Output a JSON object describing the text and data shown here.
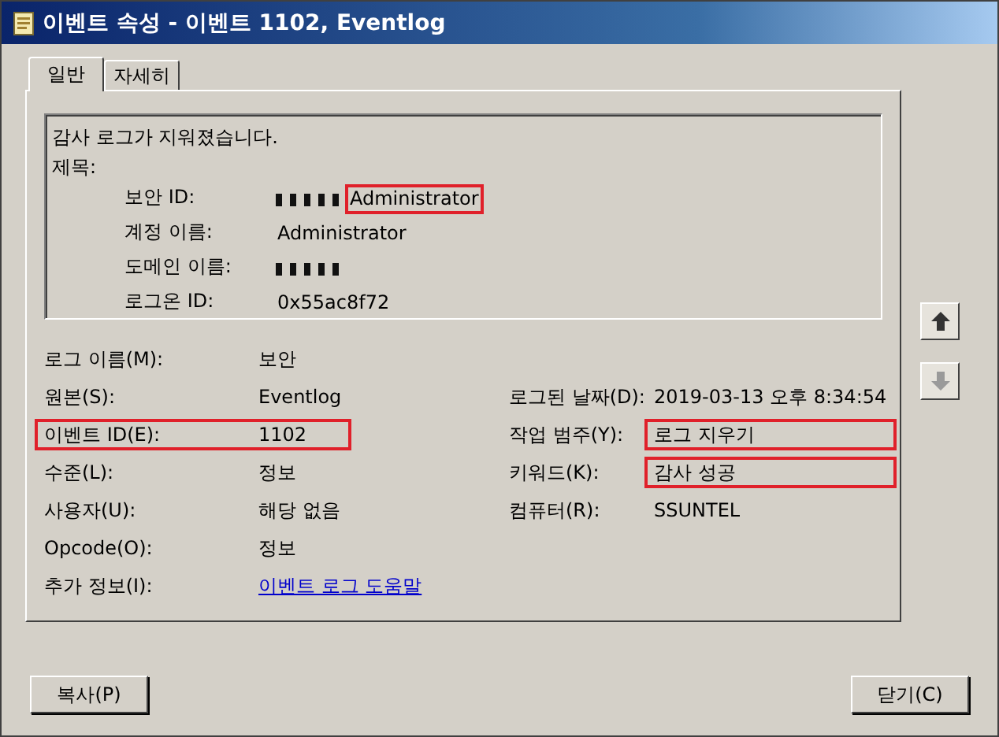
{
  "window": {
    "title": "이벤트 속성 - 이벤트 1102, Eventlog"
  },
  "tabs": [
    {
      "label": "일반",
      "selected": true
    },
    {
      "label": "자세히",
      "selected": false
    }
  ],
  "description": {
    "message": "감사 로그가 지워졌습니다.",
    "subject_label": "제목:",
    "details": [
      {
        "label": "보안 ID:",
        "value": "Administrator",
        "redacted_prefix": true,
        "highlighted": true
      },
      {
        "label": "계정 이름:",
        "value": "Administrator",
        "redacted_prefix": false,
        "highlighted": false
      },
      {
        "label": "도메인 이름:",
        "redacted_prefix": true,
        "highlighted": false
      },
      {
        "label": "로그온 ID:",
        "value": "0x55ac8f72",
        "redacted_prefix": false,
        "highlighted": false
      }
    ]
  },
  "fields": [
    {
      "left": {
        "label": "로그 이름(M):",
        "value": "보안",
        "kind": "text",
        "highlighted": false
      }
    },
    {
      "left": {
        "label": "원본(S):",
        "value": "Eventlog",
        "kind": "text",
        "highlighted": false
      },
      "right": {
        "label": "로그된 날짜(D):",
        "value": "2019-03-13 오후 8:34:54",
        "kind": "text",
        "highlighted": false
      }
    },
    {
      "left": {
        "label": "이벤트 ID(E):",
        "value": "1102",
        "kind": "text",
        "highlighted": true
      },
      "right": {
        "label": "작업 범주(Y):",
        "value": "로그 지우기",
        "kind": "text",
        "highlighted": true
      }
    },
    {
      "left": {
        "label": "수준(L):",
        "value": "정보",
        "kind": "text",
        "highlighted": false
      },
      "right": {
        "label": "키워드(K):",
        "value": "감사 성공",
        "kind": "text",
        "highlighted": true
      }
    },
    {
      "left": {
        "label": "사용자(U):",
        "value": "해당 없음",
        "kind": "text",
        "highlighted": false
      },
      "right": {
        "label": "컴퓨터(R):",
        "value": "SSUNTEL",
        "kind": "text",
        "highlighted": false
      }
    },
    {
      "left": {
        "label": "Opcode(O):",
        "value": "정보",
        "kind": "text",
        "highlighted": false
      }
    },
    {
      "left": {
        "label": "추가 정보(I):",
        "value": "이벤트 로그 도움말",
        "kind": "link",
        "highlighted": false
      }
    }
  ],
  "nav_buttons": [
    {
      "kind": "up",
      "disabled": false
    },
    {
      "kind": "down",
      "disabled": true
    }
  ],
  "buttons": [
    {
      "label": "복사(P)"
    },
    {
      "label": "닫기(C)"
    }
  ]
}
